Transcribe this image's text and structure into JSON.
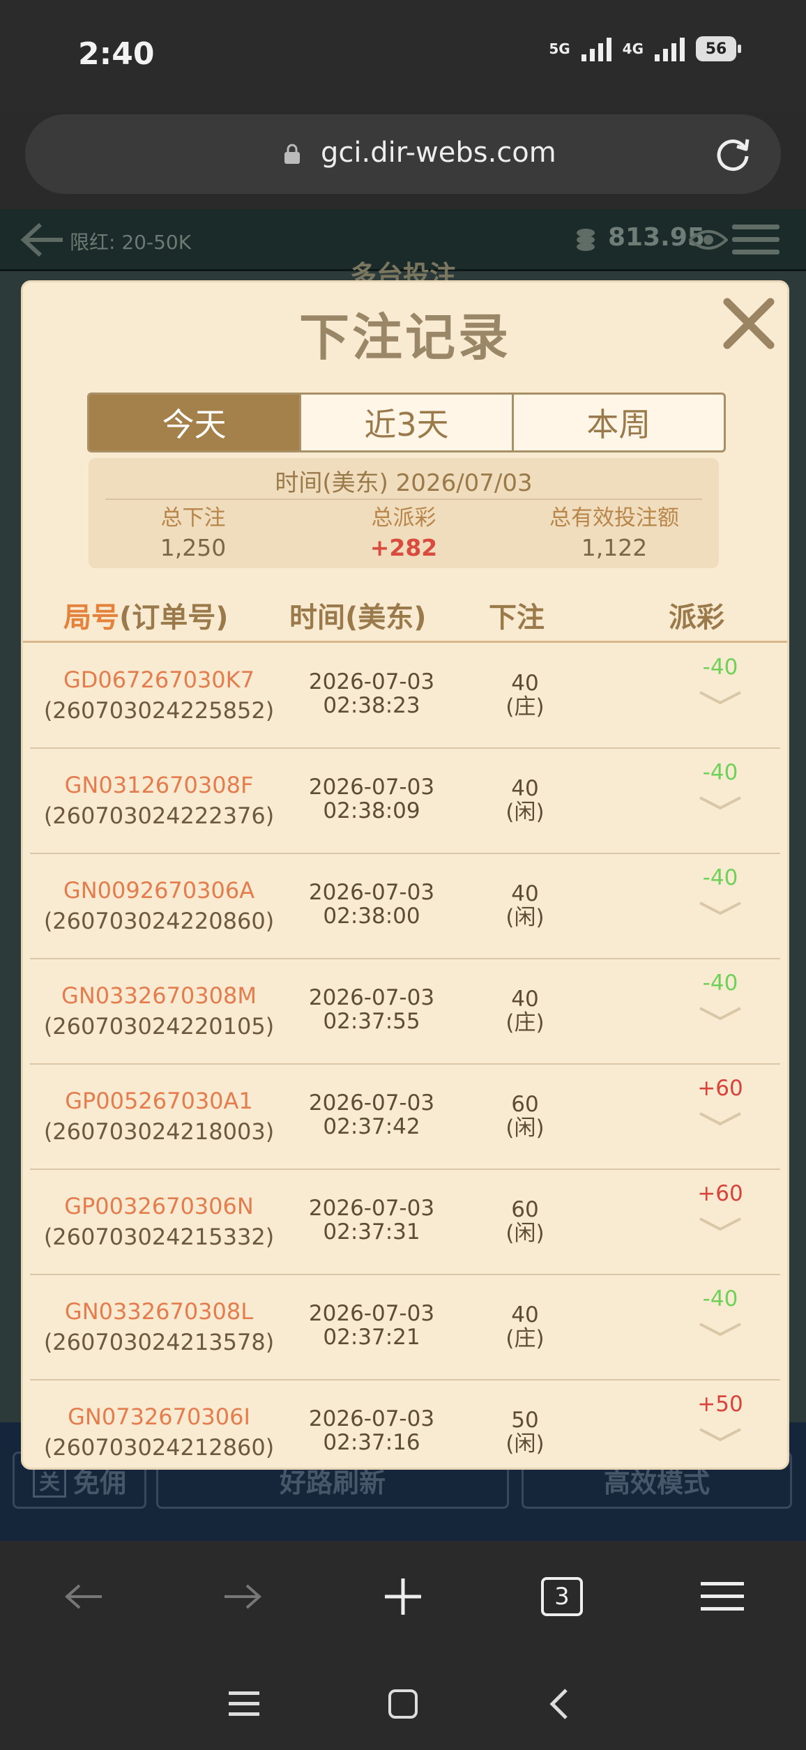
{
  "status_bar": {
    "time": "2:40",
    "net1": "5G",
    "net2": "4G",
    "battery": "56"
  },
  "browser": {
    "url": "gci.dir-webs.com",
    "tab_count": "3"
  },
  "game": {
    "limit": "限红: 20-50K",
    "balance": "813.95",
    "title": "多台投注",
    "bottom_buttons": [
      "关",
      "免佣",
      "好路刷新",
      "高效模式"
    ]
  },
  "modal": {
    "title": "下注记录",
    "tabs": [
      "今天",
      "近3天",
      "本周"
    ],
    "active_tab": "今天",
    "summary": {
      "date_line": "时间(美东) 2026/07/03",
      "total_bet_label": "总下注",
      "total_bet": "1,250",
      "total_payout_label": "总派彩",
      "total_payout": "+282",
      "total_valid_label": "总有效投注额",
      "total_valid": "1,122"
    },
    "table": {
      "headers": {
        "order_accent": "局号",
        "order_rest": "(订单号)",
        "time": "时间(美东)",
        "bet": "下注",
        "payout": "派彩"
      },
      "rows": [
        {
          "round": "GD067267030K7",
          "order": "(260703024225852)",
          "date": "2026-07-03",
          "time": "02:38:23",
          "amount": "40",
          "side": "(庄)",
          "payout": "-40"
        },
        {
          "round": "GN0312670308F",
          "order": "(260703024222376)",
          "date": "2026-07-03",
          "time": "02:38:09",
          "amount": "40",
          "side": "(闲)",
          "payout": "-40"
        },
        {
          "round": "GN0092670306A",
          "order": "(260703024220860)",
          "date": "2026-07-03",
          "time": "02:38:00",
          "amount": "40",
          "side": "(闲)",
          "payout": "-40"
        },
        {
          "round": "GN0332670308M",
          "order": "(260703024220105)",
          "date": "2026-07-03",
          "time": "02:37:55",
          "amount": "40",
          "side": "(庄)",
          "payout": "-40"
        },
        {
          "round": "GP005267030A1",
          "order": "(260703024218003)",
          "date": "2026-07-03",
          "time": "02:37:42",
          "amount": "60",
          "side": "(闲)",
          "payout": "+60"
        },
        {
          "round": "GP0032670306N",
          "order": "(260703024215332)",
          "date": "2026-07-03",
          "time": "02:37:31",
          "amount": "60",
          "side": "(闲)",
          "payout": "+60"
        },
        {
          "round": "GN0332670308L",
          "order": "(260703024213578)",
          "date": "2026-07-03",
          "time": "02:37:21",
          "amount": "40",
          "side": "(庄)",
          "payout": "-40"
        },
        {
          "round": "GN0732670306I",
          "order": "(260703024212860)",
          "date": "2026-07-03",
          "time": "02:37:16",
          "amount": "50",
          "side": "(闲)",
          "payout": "+50"
        }
      ]
    }
  },
  "colors": {
    "negative": "#6fd15a",
    "positive": "#d8433a",
    "accent": "#a4804b"
  }
}
